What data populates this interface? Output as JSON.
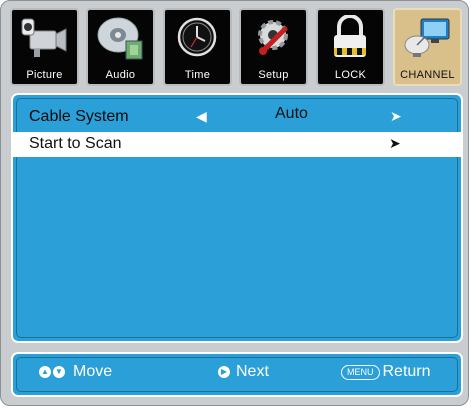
{
  "tabs": [
    {
      "label": "Picture",
      "icon": "camera-icon"
    },
    {
      "label": "Audio",
      "icon": "disc-icon"
    },
    {
      "label": "Time",
      "icon": "clock-icon"
    },
    {
      "label": "Setup",
      "icon": "gear-wrench-icon"
    },
    {
      "label": "LOCK",
      "icon": "padlock-icon"
    },
    {
      "label": "CHANNEL",
      "icon": "satellite-dish-icon"
    }
  ],
  "active_tab": "CHANNEL",
  "menu": {
    "cable_system": {
      "label": "Cable System",
      "value": "Auto",
      "left_arrow": "◀",
      "right_arrow": "➤"
    },
    "start_scan": {
      "label": "Start to Scan",
      "arrow": "➤"
    }
  },
  "footer": {
    "move_label": "Move",
    "next_label": "Next",
    "menu_key": "MENU",
    "return_label": "Return"
  },
  "colors": {
    "panel": "#2b9fd8",
    "active_tab": "#d9c08a",
    "frame": "#c9cdd0"
  }
}
